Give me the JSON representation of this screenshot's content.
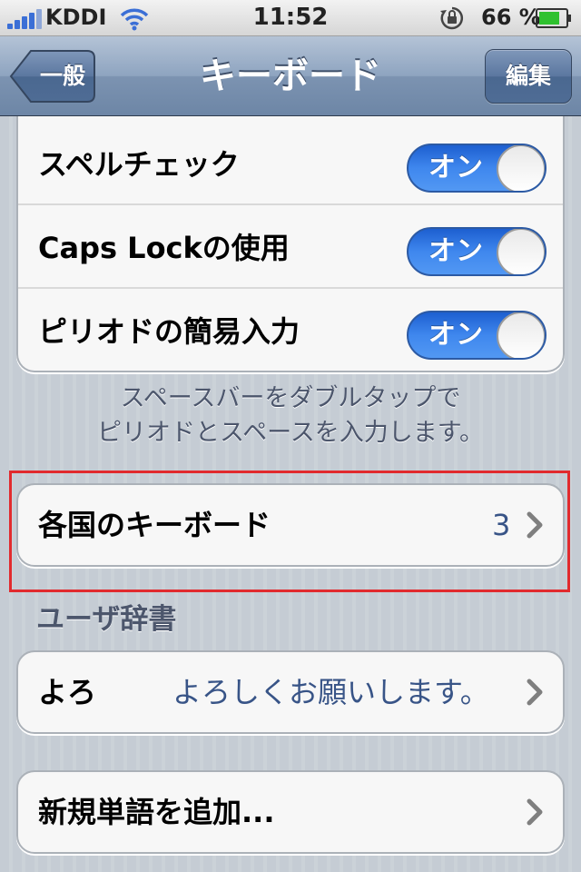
{
  "status_bar": {
    "carrier": "KDDI",
    "time": "11:52",
    "battery_percent": "66 %"
  },
  "nav": {
    "title": "キーボード",
    "back_label": "一般",
    "edit_label": "編集"
  },
  "toggles_group": {
    "items": [
      {
        "label": "スペルチェック",
        "state": "オン"
      },
      {
        "label": "Caps Lockの使用",
        "state": "オン"
      },
      {
        "label": "ピリオドの簡易入力",
        "state": "オン"
      }
    ]
  },
  "footer": {
    "line1": "スペースバーをダブルタップで",
    "line2": "ピリオドとスペースを入力します。"
  },
  "international_keyboards": {
    "label": "各国のキーボード",
    "count": "3"
  },
  "user_dictionary": {
    "header": "ユーザ辞書",
    "entry": {
      "shortcut": "よろ",
      "phrase": "よろしくお願いします。"
    },
    "add_label": "新規単語を追加..."
  },
  "colors": {
    "accent": "#3f87ee",
    "value_text": "#385487",
    "highlight": "#e12a2e"
  }
}
